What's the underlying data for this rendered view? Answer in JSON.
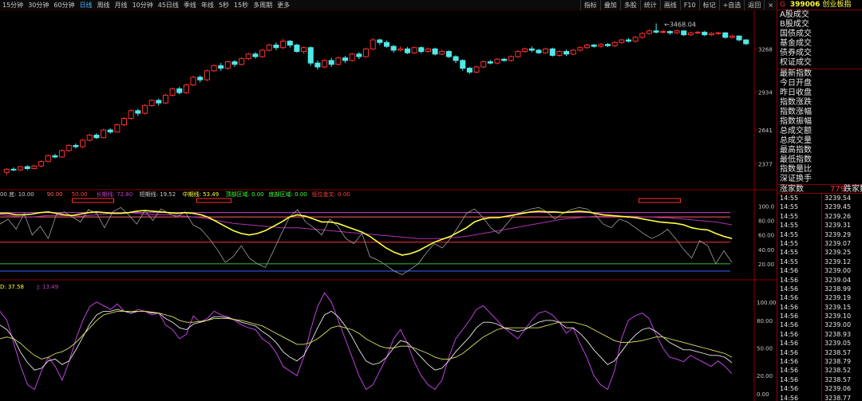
{
  "toolbar": {
    "periods": [
      "15分钟",
      "30分钟",
      "60分钟",
      "日线",
      "周线",
      "月线",
      "10分钟",
      "45日线",
      "季线",
      "年线",
      "5秒",
      "15秒",
      "多周期",
      "更多"
    ],
    "active_period": "日线",
    "tools": [
      "指标",
      "叠加",
      "多股",
      "统计",
      "画线",
      "F10",
      "标记",
      "+自选",
      "返回"
    ],
    "close_symbol": "×"
  },
  "side": {
    "marker": "G",
    "code": "399006",
    "name": "创业板指",
    "menu_a": [
      "A股成交",
      "B股成交",
      "国债成交",
      "基金成交",
      "债券成交",
      "权证成交"
    ],
    "menu_b": [
      "最新指数",
      "今日开盘",
      "昨日收盘",
      "指数涨跌",
      "指数涨幅",
      "指数振幅",
      "总成交额",
      "总成交量",
      "最高指数",
      "最低指数",
      "指数量比",
      "深证换手"
    ],
    "up_label": "涨家数",
    "up_value": "779",
    "down_label": "跌家数",
    "ticks": [
      {
        "t": "14:55",
        "p": "3239.54"
      },
      {
        "t": "14:55",
        "p": "3239.45"
      },
      {
        "t": "14:55",
        "p": "3239.26"
      },
      {
        "t": "14:55",
        "p": "3239.31"
      },
      {
        "t": "14:55",
        "p": "3239.29"
      },
      {
        "t": "14:55",
        "p": "3239.07"
      },
      {
        "t": "14:55",
        "p": "3239.25"
      },
      {
        "t": "14:55",
        "p": "3239.12"
      },
      {
        "t": "14:56",
        "p": "3239.00"
      },
      {
        "t": "14:56",
        "p": "3239.04"
      },
      {
        "t": "14:56",
        "p": "3238.99"
      },
      {
        "t": "14:56",
        "p": "3239.19"
      },
      {
        "t": "14:56",
        "p": "3239.15"
      },
      {
        "t": "14:56",
        "p": "3239.10"
      },
      {
        "t": "14:56",
        "p": "3239.00"
      },
      {
        "t": "14:56",
        "p": "3238.93"
      },
      {
        "t": "14:56",
        "p": "3239.05"
      },
      {
        "t": "14:56",
        "p": "3238.57"
      },
      {
        "t": "14:56",
        "p": "3238.79"
      },
      {
        "t": "14:56",
        "p": "3238.52"
      },
      {
        "t": "14:56",
        "p": "3238.57"
      },
      {
        "t": "14:56",
        "p": "3239.06"
      },
      {
        "t": "14:56",
        "p": "3238.77"
      }
    ]
  },
  "panel1": {
    "price_ticks": [
      3268,
      2934,
      2641,
      2377
    ],
    "high_label": "3468.04",
    "ylim": [
      2250,
      3520
    ],
    "candles": [
      [
        2310,
        2335,
        2290,
        2345
      ],
      [
        2335,
        2330,
        2320,
        2350
      ],
      [
        2330,
        2355,
        2320,
        2360
      ],
      [
        2355,
        2340,
        2330,
        2365
      ],
      [
        2340,
        2360,
        2335,
        2372
      ],
      [
        2360,
        2395,
        2350,
        2405
      ],
      [
        2395,
        2440,
        2390,
        2450
      ],
      [
        2440,
        2430,
        2420,
        2455
      ],
      [
        2430,
        2480,
        2425,
        2490
      ],
      [
        2480,
        2520,
        2470,
        2530
      ],
      [
        2520,
        2510,
        2495,
        2535
      ],
      [
        2510,
        2560,
        2500,
        2570
      ],
      [
        2560,
        2600,
        2550,
        2610
      ],
      [
        2600,
        2580,
        2570,
        2615
      ],
      [
        2580,
        2640,
        2575,
        2650
      ],
      [
        2640,
        2625,
        2610,
        2655
      ],
      [
        2625,
        2680,
        2620,
        2690
      ],
      [
        2680,
        2730,
        2670,
        2740
      ],
      [
        2730,
        2790,
        2720,
        2800
      ],
      [
        2790,
        2770,
        2750,
        2805
      ],
      [
        2770,
        2830,
        2760,
        2840
      ],
      [
        2830,
        2870,
        2820,
        2880
      ],
      [
        2870,
        2850,
        2830,
        2885
      ],
      [
        2850,
        2910,
        2840,
        2920
      ],
      [
        2910,
        2960,
        2900,
        2970
      ],
      [
        2960,
        2930,
        2915,
        2975
      ],
      [
        2930,
        2990,
        2920,
        3000
      ],
      [
        2990,
        3050,
        2980,
        3060
      ],
      [
        3050,
        3030,
        3010,
        3065
      ],
      [
        3030,
        3100,
        3020,
        3110
      ],
      [
        3100,
        3140,
        3090,
        3150
      ],
      [
        3140,
        3120,
        3100,
        3160
      ],
      [
        3120,
        3170,
        3110,
        3180
      ],
      [
        3170,
        3150,
        3130,
        3185
      ],
      [
        3150,
        3195,
        3140,
        3205
      ],
      [
        3195,
        3230,
        3185,
        3240
      ],
      [
        3230,
        3210,
        3195,
        3245
      ],
      [
        3210,
        3260,
        3200,
        3270
      ],
      [
        3260,
        3300,
        3250,
        3310
      ],
      [
        3300,
        3280,
        3260,
        3320
      ],
      [
        3280,
        3330,
        3270,
        3350
      ],
      [
        3330,
        3300,
        3280,
        3340
      ],
      [
        3300,
        3250,
        3240,
        3310
      ],
      [
        3250,
        3280,
        3230,
        3290
      ],
      [
        3280,
        3160,
        3140,
        3290
      ],
      [
        3160,
        3130,
        3110,
        3180
      ],
      [
        3130,
        3180,
        3120,
        3190
      ],
      [
        3180,
        3150,
        3130,
        3200
      ],
      [
        3150,
        3200,
        3140,
        3210
      ],
      [
        3200,
        3180,
        3160,
        3215
      ],
      [
        3180,
        3230,
        3170,
        3240
      ],
      [
        3230,
        3210,
        3190,
        3245
      ],
      [
        3210,
        3270,
        3200,
        3280
      ],
      [
        3270,
        3340,
        3260,
        3355
      ],
      [
        3340,
        3320,
        3300,
        3350
      ],
      [
        3320,
        3290,
        3280,
        3335
      ],
      [
        3290,
        3260,
        3240,
        3300
      ],
      [
        3260,
        3270,
        3250,
        3290
      ],
      [
        3270,
        3240,
        3230,
        3285
      ],
      [
        3240,
        3280,
        3230,
        3290
      ],
      [
        3280,
        3250,
        3235,
        3290
      ],
      [
        3250,
        3270,
        3240,
        3280
      ],
      [
        3270,
        3230,
        3220,
        3280
      ],
      [
        3230,
        3250,
        3220,
        3265
      ],
      [
        3250,
        3210,
        3200,
        3260
      ],
      [
        3210,
        3180,
        3160,
        3220
      ],
      [
        3180,
        3120,
        3100,
        3190
      ],
      [
        3120,
        3090,
        3075,
        3130
      ],
      [
        3090,
        3130,
        3080,
        3140
      ],
      [
        3130,
        3170,
        3120,
        3180
      ],
      [
        3170,
        3160,
        3150,
        3185
      ],
      [
        3160,
        3190,
        3150,
        3200
      ],
      [
        3190,
        3180,
        3170,
        3200
      ],
      [
        3180,
        3210,
        3170,
        3220
      ],
      [
        3210,
        3250,
        3200,
        3260
      ],
      [
        3250,
        3270,
        3240,
        3280
      ],
      [
        3270,
        3260,
        3245,
        3290
      ],
      [
        3260,
        3240,
        3230,
        3270
      ],
      [
        3240,
        3270,
        3230,
        3280
      ],
      [
        3270,
        3220,
        3210,
        3280
      ],
      [
        3220,
        3250,
        3210,
        3260
      ],
      [
        3250,
        3230,
        3215,
        3265
      ],
      [
        3230,
        3260,
        3220,
        3270
      ],
      [
        3260,
        3280,
        3250,
        3290
      ],
      [
        3280,
        3300,
        3270,
        3310
      ],
      [
        3300,
        3290,
        3280,
        3310
      ],
      [
        3290,
        3305,
        3280,
        3315
      ],
      [
        3305,
        3295,
        3285,
        3315
      ],
      [
        3295,
        3320,
        3285,
        3330
      ],
      [
        3320,
        3340,
        3310,
        3350
      ],
      [
        3340,
        3330,
        3320,
        3355
      ],
      [
        3330,
        3360,
        3320,
        3370
      ],
      [
        3360,
        3390,
        3350,
        3400
      ],
      [
        3390,
        3410,
        3380,
        3420
      ],
      [
        3410,
        3400,
        3390,
        3468
      ],
      [
        3400,
        3405,
        3390,
        3420
      ],
      [
        3405,
        3395,
        3380,
        3415
      ],
      [
        3395,
        3410,
        3385,
        3420
      ],
      [
        3410,
        3380,
        3370,
        3415
      ],
      [
        3380,
        3395,
        3370,
        3405
      ],
      [
        3395,
        3400,
        3385,
        3410
      ],
      [
        3400,
        3380,
        3370,
        3410
      ],
      [
        3380,
        3390,
        3370,
        3400
      ],
      [
        3390,
        3395,
        3380,
        3400
      ],
      [
        3395,
        3360,
        3350,
        3400
      ],
      [
        3360,
        3370,
        3350,
        3380
      ],
      [
        3370,
        3340,
        3330,
        3375
      ],
      [
        3340,
        3310,
        3300,
        3345
      ]
    ]
  },
  "panel2": {
    "legend": [
      {
        "text": "00 底: 10.00",
        "color": "#c8c8c8"
      },
      {
        "text": "90.00",
        "color": "#ff6060"
      },
      {
        "text": "50.00",
        "color": "#ff4040"
      },
      {
        "text": "长期线: 72.80",
        "color": "#c040c0"
      },
      {
        "text": "短期线: 19.52",
        "color": "#c8c8c8"
      },
      {
        "text": "中期线: 53.49",
        "color": "#ffff40"
      },
      {
        "text": "顶部区域: 0.00",
        "color": "#40ff40"
      },
      {
        "text": "底部区域: 0.00",
        "color": "#40ff40"
      },
      {
        "text": "低位金叉: 0.00",
        "color": "#ff4040"
      }
    ],
    "axis": [
      "100.0",
      "80.00",
      "60.00",
      "40.00",
      "20.00"
    ],
    "ylim": [
      0,
      105
    ],
    "short": [
      75,
      82,
      68,
      90,
      60,
      72,
      55,
      88,
      92,
      85,
      78,
      95,
      90,
      70,
      92,
      98,
      88,
      75,
      94,
      80,
      96,
      90,
      85,
      92,
      74,
      68,
      55,
      40,
      22,
      30,
      45,
      28,
      20,
      15,
      38,
      62,
      85,
      95,
      78,
      70,
      60,
      82,
      72,
      55,
      48,
      62,
      30,
      25,
      18,
      10,
      5,
      12,
      20,
      35,
      48,
      42,
      55,
      72,
      90,
      96,
      85,
      70,
      62,
      75,
      88,
      92,
      96,
      98,
      92,
      82,
      90,
      95,
      98,
      96,
      88,
      75,
      70,
      82,
      78,
      70,
      62,
      55,
      60,
      68,
      55,
      40,
      28,
      52,
      45,
      20,
      38,
      22
    ],
    "mid": [
      90,
      90,
      88,
      88,
      89,
      91,
      92,
      90,
      88,
      87,
      89,
      91,
      92,
      91,
      90,
      90,
      91,
      93,
      94,
      93,
      92,
      91,
      90,
      91,
      90,
      88,
      84,
      78,
      72,
      66,
      62,
      60,
      62,
      66,
      72,
      78,
      85,
      88,
      86,
      82,
      78,
      78,
      76,
      72,
      68,
      64,
      58,
      50,
      42,
      36,
      32,
      34,
      38,
      44,
      50,
      54,
      58,
      64,
      70,
      78,
      82,
      84,
      84,
      86,
      88,
      90,
      92,
      93,
      92,
      92,
      91,
      92,
      93,
      92,
      90,
      88,
      87,
      86,
      85,
      84,
      82,
      80,
      78,
      77,
      76,
      74,
      70,
      68,
      67,
      62,
      58,
      55
    ],
    "long": [
      88,
      87,
      86,
      85,
      85,
      86,
      87,
      87,
      87,
      87,
      86,
      87,
      88,
      89,
      90,
      91,
      91,
      90,
      89,
      88,
      88,
      88,
      87,
      86,
      85,
      84,
      82,
      80,
      78,
      76,
      75,
      74,
      73,
      72,
      71,
      70,
      70,
      70,
      69,
      68,
      67,
      66,
      65,
      64,
      63,
      62,
      61,
      60,
      59,
      58,
      57,
      56,
      55,
      55,
      55,
      55,
      56,
      57,
      58,
      60,
      62,
      64,
      66,
      68,
      70,
      72,
      74,
      76,
      78,
      80,
      82,
      83,
      84,
      85,
      86,
      86,
      86,
      86,
      86,
      86,
      85,
      85,
      84,
      84,
      83,
      82,
      81,
      80,
      79,
      78,
      76,
      74
    ],
    "hlines": [
      {
        "v": 91,
        "color": "#d040d0"
      },
      {
        "v": 85,
        "color": "#ff6060"
      },
      {
        "v": 50,
        "color": "#ff3030"
      },
      {
        "v": 20,
        "color": "#30c030"
      },
      {
        "v": 10,
        "color": "#4060ff"
      }
    ],
    "top_zones": [
      [
        10,
        16
      ],
      [
        28,
        33
      ],
      [
        92,
        98
      ],
      [
        152,
        158
      ]
    ]
  },
  "panel3": {
    "legend": [
      {
        "text": "D: 37.58",
        "color": "#ffff40"
      },
      {
        "text": "J: 13.49",
        "color": "#c040c0"
      }
    ],
    "axis": [
      "100.00",
      "80.00",
      "50.00",
      "20.00",
      "0.00"
    ],
    "ylim": [
      -5,
      112
    ],
    "k": [
      90,
      80,
      55,
      30,
      10,
      5,
      25,
      40,
      30,
      15,
      35,
      60,
      80,
      95,
      100,
      96,
      92,
      98,
      90,
      88,
      92,
      90,
      86,
      88,
      75,
      70,
      60,
      65,
      85,
      78,
      82,
      90,
      86,
      84,
      80,
      75,
      72,
      70,
      60,
      55,
      45,
      30,
      25,
      20,
      40,
      70,
      95,
      110,
      100,
      80,
      60,
      40,
      20,
      5,
      10,
      25,
      40,
      60,
      70,
      55,
      35,
      20,
      10,
      5,
      15,
      40,
      60,
      70,
      80,
      92,
      96,
      88,
      80,
      72,
      66,
      60,
      70,
      80,
      88,
      90,
      86,
      78,
      66,
      72,
      55,
      40,
      20,
      10,
      5,
      25,
      60,
      80,
      85,
      88,
      82,
      65,
      50,
      40,
      38,
      35,
      42,
      38,
      34,
      30,
      36,
      30,
      22
    ],
    "d": [
      60,
      62,
      60,
      55,
      48,
      42,
      38,
      40,
      44,
      46,
      50,
      56,
      64,
      72,
      80,
      86,
      88,
      90,
      90,
      90,
      90,
      90,
      89,
      88,
      86,
      84,
      80,
      78,
      78,
      79,
      80,
      82,
      82,
      82,
      81,
      80,
      78,
      76,
      74,
      70,
      66,
      62,
      58,
      54,
      54,
      56,
      60,
      66,
      72,
      74,
      72,
      70,
      66,
      60,
      56,
      52,
      50,
      50,
      52,
      52,
      50,
      47,
      44,
      40,
      38,
      38,
      40,
      44,
      50,
      56,
      62,
      66,
      70,
      72,
      72,
      72,
      72,
      72,
      72,
      74,
      76,
      78,
      78,
      78,
      76,
      74,
      70,
      66,
      62,
      58,
      56,
      56,
      57,
      58,
      60,
      62,
      62,
      60,
      58,
      56,
      54,
      52,
      50,
      48,
      46,
      44,
      40
    ],
    "kk": [
      75,
      70,
      60,
      45,
      34,
      26,
      28,
      36,
      38,
      32,
      36,
      48,
      62,
      76,
      86,
      90,
      90,
      92,
      90,
      88,
      90,
      90,
      88,
      88,
      82,
      78,
      72,
      70,
      76,
      78,
      80,
      84,
      84,
      83,
      81,
      78,
      76,
      74,
      68,
      63,
      56,
      46,
      40,
      36,
      42,
      56,
      72,
      86,
      90,
      84,
      74,
      62,
      48,
      36,
      32,
      34,
      40,
      50,
      58,
      56,
      48,
      40,
      32,
      26,
      28,
      36,
      46,
      54,
      62,
      72,
      78,
      78,
      76,
      72,
      70,
      68,
      70,
      74,
      78,
      80,
      80,
      78,
      72,
      72,
      66,
      58,
      48,
      40,
      32,
      36,
      46,
      56,
      64,
      70,
      72,
      68,
      62,
      56,
      52,
      48,
      48,
      46,
      44,
      42,
      42,
      40,
      34
    ]
  }
}
